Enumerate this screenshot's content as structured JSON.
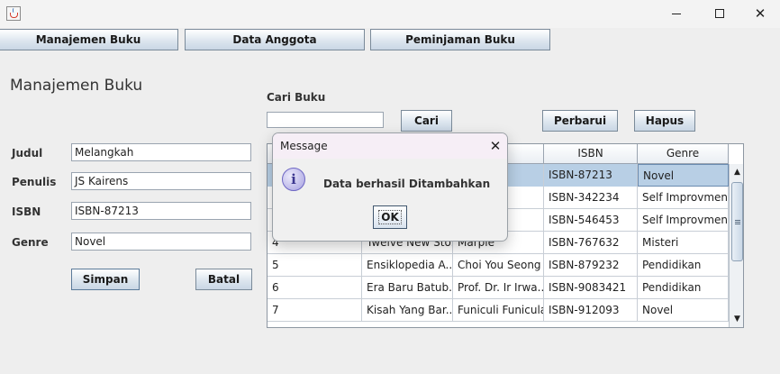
{
  "window": {
    "title": ""
  },
  "nav": {
    "manajemen_buku": "Manajemen Buku",
    "data_anggota": "Data Anggota",
    "peminjaman_buku": "Peminjaman Buku"
  },
  "form": {
    "heading": "Manajemen Buku",
    "judul_label": "Judul",
    "judul_value": "Melangkah",
    "penulis_label": "Penulis",
    "penulis_value": "JS Kairens",
    "isbn_label": "ISBN",
    "isbn_value": "ISBN-87213",
    "genre_label": "Genre",
    "genre_value": "Novel",
    "simpan": "Simpan",
    "batal": "Batal"
  },
  "search": {
    "label": "Cari Buku",
    "value": "",
    "cari": "Cari",
    "perbarui": "Perbarui",
    "hapus": "Hapus"
  },
  "table": {
    "columns": [
      "",
      "",
      "lis",
      "ISBN",
      "Genre"
    ],
    "rows": [
      {
        "no": "",
        "judul": "",
        "penulis": "s",
        "isbn": "ISBN-87213",
        "genre": "Novel"
      },
      {
        "no": "",
        "judul": "",
        "penulis": "wrick",
        "isbn": "ISBN-342234",
        "genre": "Self Improvment"
      },
      {
        "no": "",
        "judul": "",
        "penulis": "ng",
        "isbn": "ISBN-546453",
        "genre": "Self Improvment"
      },
      {
        "no": "4",
        "judul": "Twelve New Sto...",
        "penulis": "Marple",
        "isbn": "ISBN-767632",
        "genre": "Misteri"
      },
      {
        "no": "5",
        "judul": "Ensiklopedia A...",
        "penulis": "Choi You Seong",
        "isbn": "ISBN-879232",
        "genre": "Pendidikan"
      },
      {
        "no": "6",
        "judul": "Era Baru Batub...",
        "penulis": "Prof. Dr. Ir Irwa...",
        "isbn": "ISBN-9083421",
        "genre": "Pendidikan"
      },
      {
        "no": "7",
        "judul": "Kisah Yang Bar...",
        "penulis": "Funiculi Funicula",
        "isbn": "ISBN-912093",
        "genre": "Novel"
      }
    ]
  },
  "dialog": {
    "title": "Message",
    "message": "Data berhasil Ditambahkan",
    "ok": "OK"
  },
  "icons": {
    "app": "java-icon",
    "info": "info-icon"
  },
  "colors": {
    "selected_row": "#b8cfe5",
    "button_gradient_end": "#c9d6e4",
    "dialog_title": "#f6eef6"
  }
}
